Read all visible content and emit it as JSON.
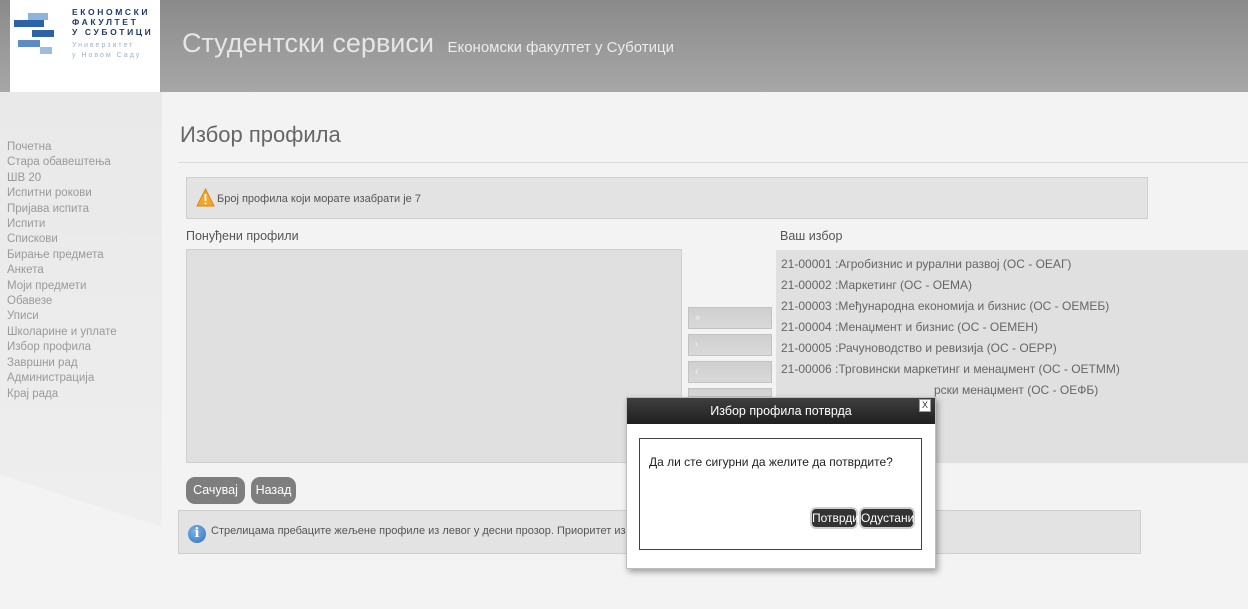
{
  "header": {
    "logo_lines": [
      "ЕКОНОМСКИ",
      "ФАКУЛТЕТ",
      "У СУБОТИЦИ"
    ],
    "logo_sub_lines": [
      "Универзитет",
      "у Новом Саду"
    ],
    "title": "Студентски сервиси",
    "subtitle": "Економски факултет у Суботици"
  },
  "sidebar": {
    "items": [
      "Почетна",
      "Стара обавештења",
      "ШВ 20",
      "Испитни рокови",
      "Пријава испита",
      "Испити",
      "Спискови",
      "Бирање предмета",
      "Анкета",
      "Моји предмети",
      "Обавезе",
      "Уписи",
      "Школарине и уплате",
      "Избор профила",
      "Завршни рад",
      "Администрација",
      "Крај рада"
    ]
  },
  "page": {
    "title": "Избор профила",
    "warning": "Број профила који морате изабрати је 7",
    "offered_label": "Понуђени профили",
    "selected_label": "Ваш избор",
    "selected_items": [
      "21-00001 :Агробизнис и рурални развој (ОС - ОЕАГ)",
      "21-00002 :Маркетинг (ОС - ОЕМА)",
      "21-00003 :Међународна економија и бизнис (ОС - ОЕМЕБ)",
      "21-00004 :Менаџмент и бизнис (ОС - ОЕМЕН)",
      "21-00005 :Рачуноводство и ревизија (ОС - ОЕРР)",
      "21-00006 :Трговински маркетинг и менаџмент (ОС - ОЕТММ)",
      "рски менаџмент (ОС - ОЕФБ)"
    ],
    "arrow_buttons": [
      "»",
      "›",
      "‹"
    ],
    "save_label": "Сачувај",
    "back_label": "Назад",
    "info": "Стрелицама пребаците жељене профиле из левог у десни прозор. Приоритет избора"
  },
  "dialog": {
    "title": "Избор профила потврда",
    "close": "X",
    "message": "Да ли сте сигурни да желите да потврдите?",
    "confirm_label": "Потврди",
    "cancel_label": "Одустани"
  }
}
